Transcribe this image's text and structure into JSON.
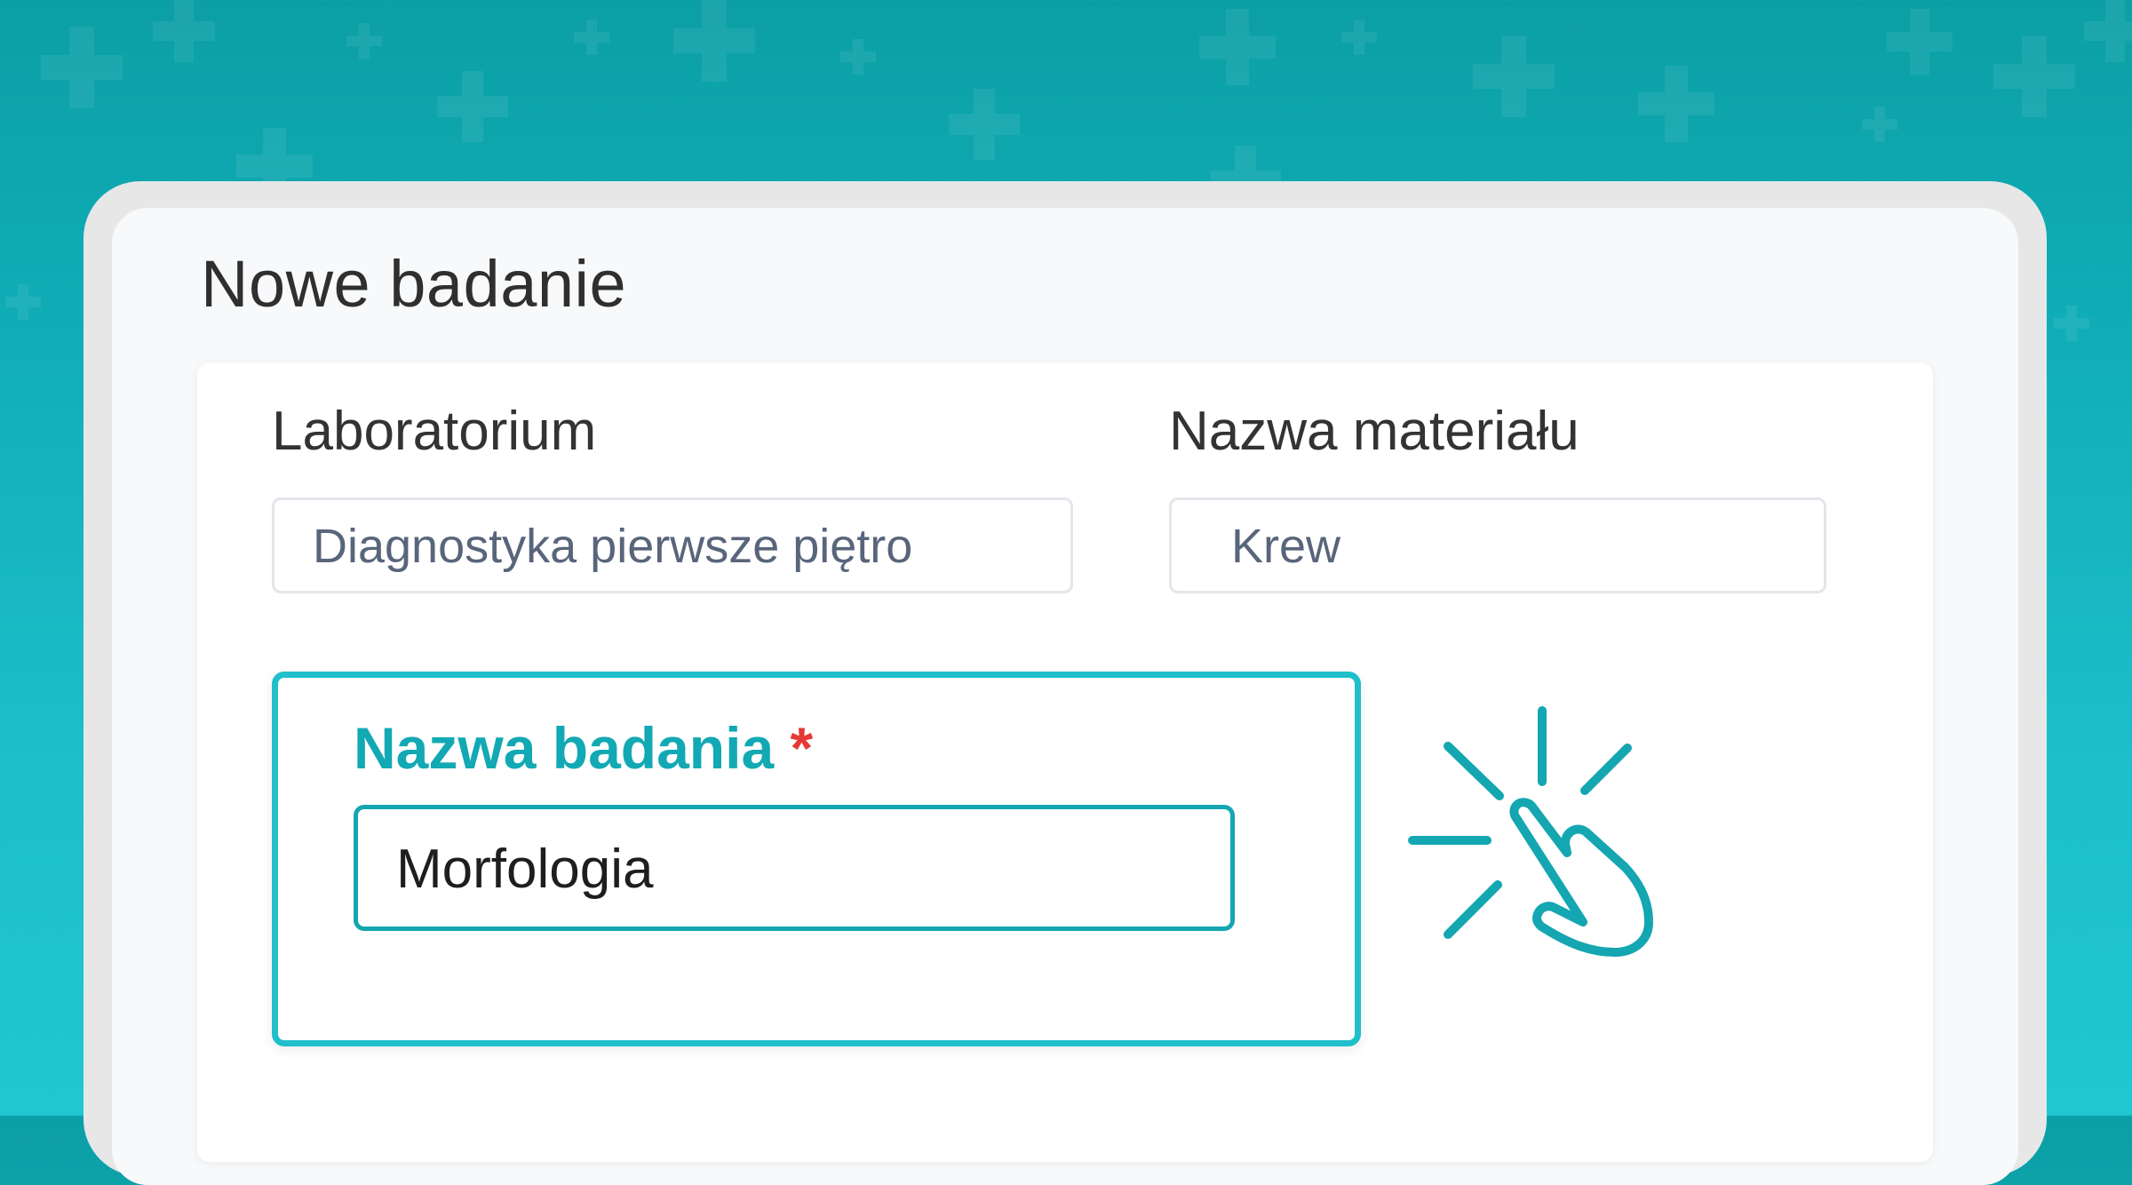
{
  "page": {
    "title": "Nowe badanie"
  },
  "form": {
    "laboratory": {
      "label": "Laboratorium",
      "value": "Diagnostyka pierwsze piętro"
    },
    "material": {
      "label": "Nazwa materiału",
      "value": "Krew"
    },
    "test_name": {
      "label": "Nazwa badania",
      "required_marker": "*",
      "value": "Morfologia"
    }
  },
  "icons": {
    "click": "pointer-click-icon",
    "background": "medical-cross-icon"
  },
  "colors": {
    "accent": "#20bfcb",
    "accent_dark": "#12a9b4",
    "required": "#e53935",
    "background_top": "#0b9fa5",
    "background_bottom": "#20c6d1"
  }
}
